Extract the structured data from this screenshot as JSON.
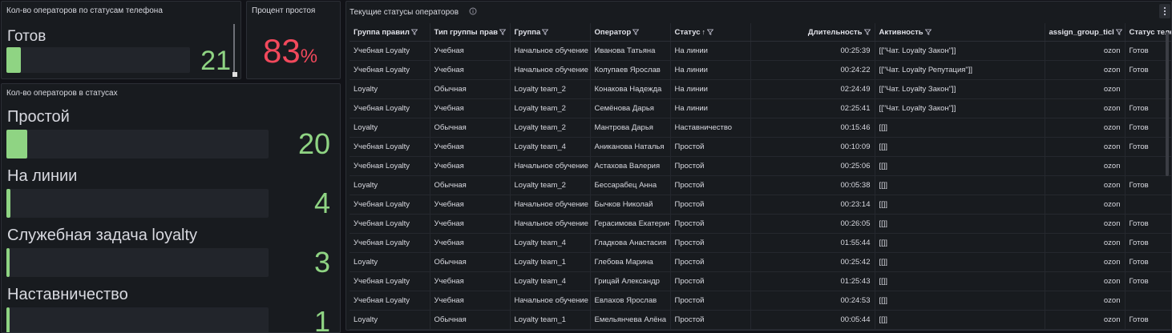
{
  "phone_panel": {
    "title": "Кол-во операторов по статусам телефона",
    "item_label": "Готов",
    "item_value": "21",
    "fill_fraction": 0.08
  },
  "idle_panel": {
    "title": "Процент простоя",
    "value": "83",
    "unit": "%"
  },
  "status_panel": {
    "title": "Кол-во операторов в статусах",
    "items": [
      {
        "label": "Простой",
        "value": "20",
        "fill_fraction": 0.08
      },
      {
        "label": "На линии",
        "value": "4",
        "fill_fraction": 0.016
      },
      {
        "label": "Служебная задача loyalty",
        "value": "3",
        "fill_fraction": 0.012
      },
      {
        "label": "Наставничество",
        "value": "1",
        "fill_fraction": 0.012
      }
    ]
  },
  "table_panel": {
    "title": "Текущие статусы операторов",
    "info_icon": "info-circle-icon",
    "menu_icon": "kebab-menu-icon",
    "columns": [
      "Группа правил",
      "Тип группы прав",
      "Группа",
      "Оператор",
      "Статус",
      "Длительность",
      "Активность",
      "assign_group_ticl",
      "Статус теле"
    ],
    "sorted_column": "Статус",
    "sort_direction": "asc",
    "rows": [
      [
        "Учебная Loyalty",
        "Учебная",
        "Начальное обучение",
        "Иванова Татьяна",
        "На линии",
        "00:25:39",
        "[[\"Чат. Loyalty Закон\"]]",
        "ozon",
        "Готов"
      ],
      [
        "Учебная Loyalty",
        "Учебная",
        "Начальное обучение",
        "Колупаев Ярослав",
        "На линии",
        "00:24:22",
        "[[\"Чат. Loyalty Репутация\"]]",
        "ozon",
        "Готов"
      ],
      [
        "Loyalty",
        "Обычная",
        "Loyalty team_2",
        "Конакова Надежда",
        "На линии",
        "02:24:49",
        "[[\"Чат. Loyalty Закон\"]]",
        "ozon",
        ""
      ],
      [
        "Учебная Loyalty",
        "Учебная",
        "Loyalty team_2",
        "Семёнова Дарья",
        "На линии",
        "02:25:41",
        "[[\"Чат. Loyalty Закон\"]]",
        "ozon",
        "Готов"
      ],
      [
        "Loyalty",
        "Обычная",
        "Loyalty team_2",
        "Мантрова Дарья",
        "Наставничество",
        "00:15:46",
        "[[]]",
        "ozon",
        "Готов"
      ],
      [
        "Учебная Loyalty",
        "Учебная",
        "Loyalty team_4",
        "Аниканова Наталья",
        "Простой",
        "00:10:09",
        "[[]]",
        "ozon",
        "Готов"
      ],
      [
        "Учебная Loyalty",
        "Учебная",
        "Начальное обучение",
        "Астахова Валерия",
        "Простой",
        "00:25:06",
        "[[]]",
        "ozon",
        ""
      ],
      [
        "Loyalty",
        "Обычная",
        "Loyalty team_2",
        "Бессарабец Анна",
        "Простой",
        "00:05:38",
        "[[]]",
        "ozon",
        "Готов"
      ],
      [
        "Учебная Loyalty",
        "Учебная",
        "Начальное обучение",
        "Бычков Николай",
        "Простой",
        "00:23:14",
        "[[]]",
        "ozon",
        ""
      ],
      [
        "Учебная Loyalty",
        "Учебная",
        "Начальное обучение",
        "Герасимова Екатерина",
        "Простой",
        "00:26:05",
        "[[]]",
        "ozon",
        "Готов"
      ],
      [
        "Учебная Loyalty",
        "Учебная",
        "Loyalty team_4",
        "Гладкова Анастасия",
        "Простой",
        "01:55:44",
        "[[]]",
        "ozon",
        "Готов"
      ],
      [
        "Loyalty",
        "Обычная",
        "Loyalty team_1",
        "Глебова Марина",
        "Простой",
        "00:25:42",
        "[[]]",
        "ozon",
        "Готов"
      ],
      [
        "Учебная Loyalty",
        "Учебная",
        "Loyalty team_4",
        "Грицай Александр",
        "Простой",
        "01:25:43",
        "[[]]",
        "ozon",
        "Готов"
      ],
      [
        "Учебная Loyalty",
        "Учебная",
        "Начальное обучение",
        "Евлахов Ярослав",
        "Простой",
        "00:24:53",
        "[[]]",
        "ozon",
        ""
      ],
      [
        "Loyalty",
        "Обычная",
        "Loyalty team_1",
        "Емельянчева Алёна",
        "Простой",
        "00:05:44",
        "[[]]",
        "ozon",
        "Готов"
      ]
    ]
  },
  "colors": {
    "background": "#111217",
    "panel": "#181b1f",
    "bar_fill": "#8fd483",
    "value_green": "#8fd483",
    "value_red": "#f2495c"
  }
}
